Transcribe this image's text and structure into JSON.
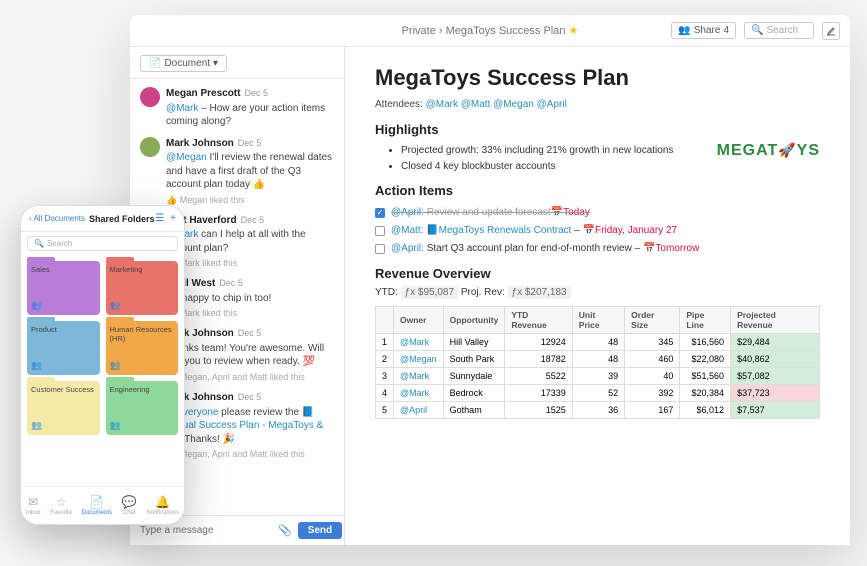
{
  "breadcrumb": {
    "root": "Private",
    "sep": "›",
    "title": "MegaToys Success Plan"
  },
  "topbar": {
    "share_label": "Share",
    "share_count": "4",
    "search_placeholder": "Search"
  },
  "sidebar": {
    "doc_selector": "Document"
  },
  "chat": {
    "messages": [
      {
        "name": "Megan Prescott",
        "date": "Dec 5",
        "avatar": "#c48",
        "text_pre": "",
        "mention": "@Mark",
        "text_post": " – How are your action items coming along?",
        "liked": ""
      },
      {
        "name": "Mark Johnson",
        "date": "Dec 5",
        "avatar": "#8a5",
        "text_pre": "",
        "mention": "@Megan",
        "text_post": " I'll review the renewal dates and have a first draft of the Q3 account plan today 👍",
        "liked": "Megan liked this"
      },
      {
        "name": "Matt Haverford",
        "date": "Dec 5",
        "avatar": "#555",
        "text_pre": "",
        "mention": "@Mark",
        "text_post": " can I help at all with the account plan?",
        "liked": "Mark liked this"
      },
      {
        "name": "April West",
        "date": "Dec 5",
        "avatar": "#b73",
        "text_pre": "I'm happy to chip in too!",
        "mention": "",
        "text_post": "",
        "liked": "Mark liked this"
      },
      {
        "name": "Mark Johnson",
        "date": "Dec 5",
        "avatar": "#8a5",
        "text_pre": "Thanks team! You're awesome. Will ask you to review when ready. 💯",
        "mention": "",
        "text_post": "",
        "liked": "Megan, April and Matt liked this"
      },
      {
        "name": "Mark Johnson",
        "date": "Dec 5",
        "avatar": "#8a5",
        "text_pre": "",
        "mention": "@Everyone",
        "text_post": " please review the ",
        "doc_link": "📘Mutual Success Plan - MegaToys & CL",
        "tail": ". Thanks! 🎉",
        "liked": "Megan, April and Matt liked this"
      }
    ],
    "input_placeholder": "Type a message",
    "send_label": "Send"
  },
  "doc": {
    "title": "MegaToys Success Plan",
    "attendees_label": "Attendees:",
    "attendees": [
      "@Mark",
      "@Matt",
      "@Megan",
      "@April"
    ],
    "logo_text": "MEGAT  YS",
    "highlights_heading": "Highlights",
    "highlights": [
      "Projected growth: 33% including 21% growth in new locations",
      "Closed 4 key blockbuster accounts"
    ],
    "action_heading": "Action Items",
    "actions": [
      {
        "checked": true,
        "mention": "@April:",
        "text": "Review and update forecast",
        "due": "📅Today",
        "strike": true
      },
      {
        "checked": false,
        "mention": "@Matt:",
        "doc": "📘MegaToys Renewals Contract",
        "dash": " – ",
        "due": "📅Friday, January 27",
        "strike": false
      },
      {
        "checked": false,
        "mention": "@April:",
        "text": "Start Q3 account plan for end-of-month review – ",
        "due": "📅Tomorrow",
        "strike": false
      }
    ],
    "revenue_heading": "Revenue Overview",
    "ytd_label": "YTD:",
    "ytd_val": "ƒx $95,087",
    "proj_label": "Proj. Rev:",
    "proj_val": "ƒx $207,183",
    "table": {
      "headers": [
        "",
        "Owner",
        "Opportunity",
        "YTD Revenue",
        "Unit Price",
        "Order Size",
        "Pipe Line",
        "Projected Revenue"
      ],
      "rows": [
        {
          "n": "1",
          "owner": "@Mark",
          "opp": "Hill Valley",
          "ytd": "12924",
          "price": "48",
          "size": "345",
          "pipe": "$16,560",
          "proj": "$29,484",
          "cls": "proj-green"
        },
        {
          "n": "2",
          "owner": "@Megan",
          "opp": "South Park",
          "ytd": "18782",
          "price": "48",
          "size": "460",
          "pipe": "$22,080",
          "proj": "$40,862",
          "cls": "proj-green"
        },
        {
          "n": "3",
          "owner": "@Mark",
          "opp": "Sunnydale",
          "ytd": "5522",
          "price": "39",
          "size": "40",
          "pipe": "$51,560",
          "proj": "$57,082",
          "cls": "proj-green"
        },
        {
          "n": "4",
          "owner": "@Mark",
          "opp": "Bedrock",
          "ytd": "17339",
          "price": "52",
          "size": "392",
          "pipe": "$20,384",
          "proj": "$37,723",
          "cls": "proj-red"
        },
        {
          "n": "5",
          "owner": "@April",
          "opp": "Gotham",
          "ytd": "1525",
          "price": "36",
          "size": "167",
          "pipe": "$6,012",
          "proj": "$7,537",
          "cls": "proj-green"
        }
      ]
    }
  },
  "phone": {
    "back": "‹ All Documents",
    "title": "Shared Folders",
    "search_placeholder": "Search",
    "folders": [
      {
        "label": "Sales",
        "cls": "sales"
      },
      {
        "label": "Marketing",
        "cls": "marketing"
      },
      {
        "label": "Product",
        "cls": "product"
      },
      {
        "label": "Human Resources (HR)",
        "cls": "hr"
      },
      {
        "label": "Customer Success",
        "cls": "cs"
      },
      {
        "label": "Engineering",
        "cls": "eng"
      }
    ],
    "tabs": [
      "Inbox",
      "Favorite",
      "Documents",
      "Chat",
      "Notifications"
    ]
  }
}
